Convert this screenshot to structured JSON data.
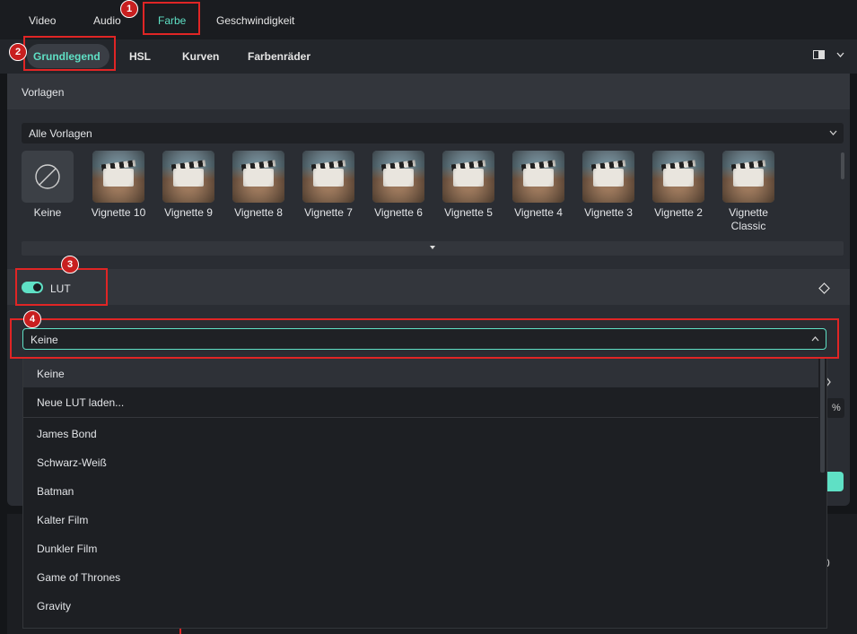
{
  "top_tabs": [
    "Video",
    "Audio",
    "Farbe",
    "Geschwindigkeit"
  ],
  "sub_tabs": [
    "Grundlegend",
    "HSL",
    "Kurven",
    "Farbenräder"
  ],
  "vorlagen": {
    "title": "Vorlagen",
    "filter": "Alle Vorlagen",
    "items": [
      "Keine",
      "Vignette 10",
      "Vignette 9",
      "Vignette 8",
      "Vignette 7",
      "Vignette 6",
      "Vignette 5",
      "Vignette 4",
      "Vignette 3",
      "Vignette 2"
    ],
    "last_item_line1": "Vignette",
    "last_item_line2": "Classic"
  },
  "lut": {
    "label": "LUT",
    "enabled": true,
    "selected": "Keine",
    "options": [
      "Keine",
      "Neue LUT laden...",
      "James Bond",
      "Schwarz-Weiß",
      "Batman",
      "Kalter Film",
      "Dunkler Film",
      "Game of Thrones",
      "Gravity"
    ]
  },
  "badges": [
    "1",
    "2",
    "3",
    "4"
  ],
  "side_glyphs": {
    "percent": "%",
    "zero": "0"
  },
  "colors": {
    "accent": "#5fe0c5",
    "callout": "#e02525"
  }
}
